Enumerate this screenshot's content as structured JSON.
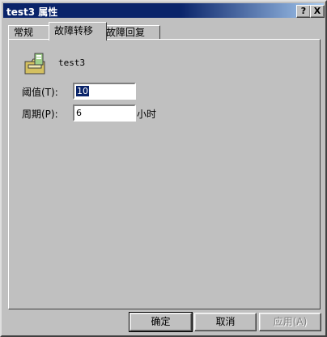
{
  "window": {
    "title": "test3 属性",
    "help_icon": "?",
    "close_icon": "X"
  },
  "tabs": [
    {
      "label": "常规",
      "active": false
    },
    {
      "label": "故障转移",
      "active": true
    },
    {
      "label": "故障回复",
      "active": false
    }
  ],
  "resource": {
    "icon": "cluster-group-folder-icon",
    "name": "test3"
  },
  "threshold": {
    "label": "阈值(T):",
    "value": "10"
  },
  "period": {
    "label": "周期(P):",
    "value": "6",
    "unit": "小时"
  },
  "buttons": {
    "ok": "确定",
    "cancel": "取消",
    "apply": "应用(A)"
  }
}
